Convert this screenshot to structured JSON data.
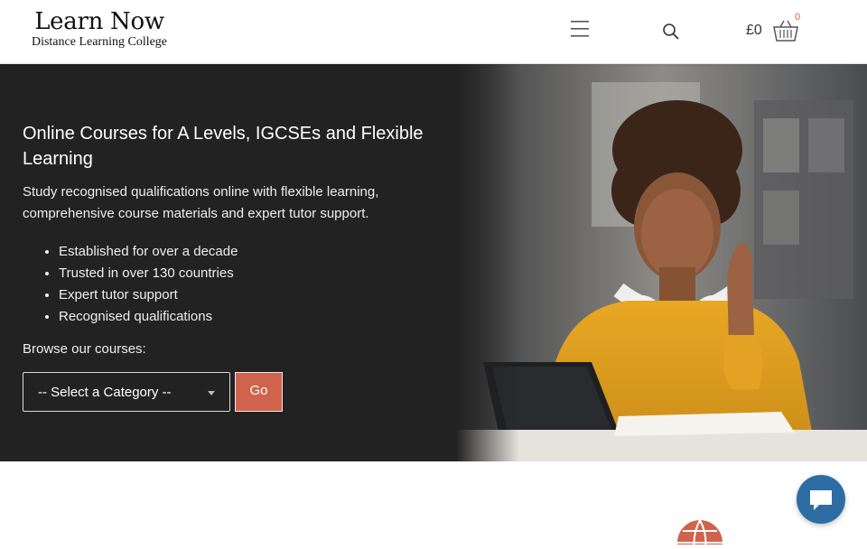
{
  "header": {
    "logo_title": "Learn Now",
    "logo_subtitle": "Distance Learning College",
    "menu_icon": "hamburger-icon",
    "search_icon": "search-icon",
    "cart_total": "£0",
    "cart_icon": "basket-icon",
    "cart_count": "0"
  },
  "hero": {
    "title": "Online Courses for A Levels, IGCSEs and Flexible Learning",
    "subtitle": "Study recognised qualifications online with flexible learning, comprehensive course materials and expert tutor support.",
    "features": [
      "Established for over a decade",
      "Trusted in over 130 countries",
      "Expert tutor support",
      "Recognised qualifications"
    ],
    "browse_label": "Browse our courses:",
    "category_select": {
      "value": "-- Select a Category --"
    },
    "go_label": "Go"
  },
  "colors": {
    "accent": "#d0634c",
    "hero_bg": "#222222",
    "chat_button": "#2e6da4"
  },
  "icons": {
    "globe": "globe-icon",
    "chat": "chat-bubble-icon"
  }
}
